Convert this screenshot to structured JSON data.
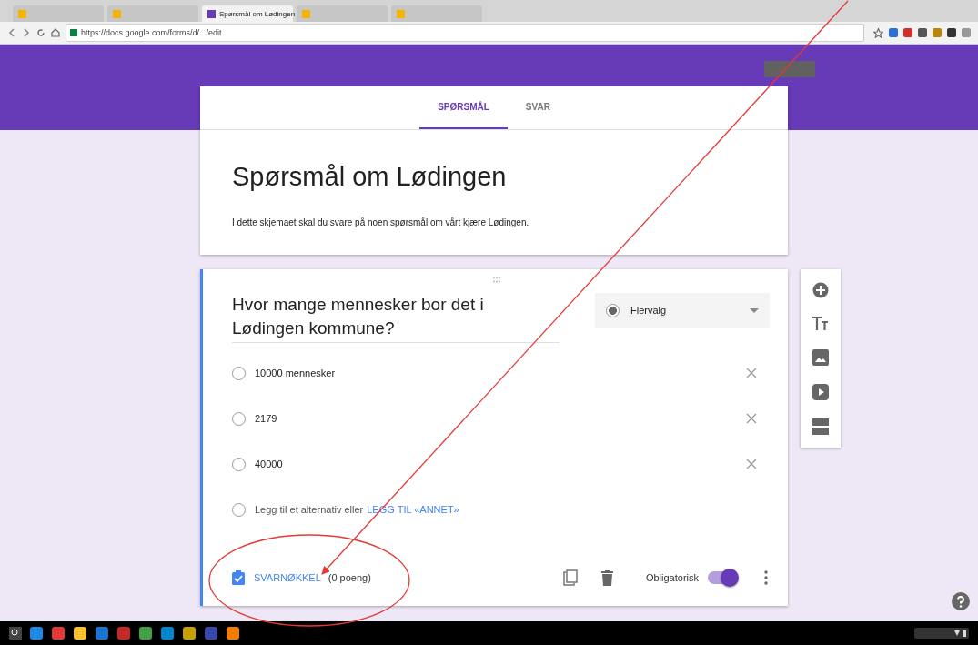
{
  "browser": {
    "tabs": [
      {
        "selected": false
      },
      {
        "selected": false
      },
      {
        "title": "Spørsmål om Lødingen",
        "selected": true
      },
      {
        "selected": false
      },
      {
        "selected": false
      }
    ],
    "address": "https://docs.google.com/forms/d/.../edit"
  },
  "form_tabs": [
    {
      "label": "SPØRSMÅL",
      "selected": true
    },
    {
      "label": "SVAR",
      "selected": false
    }
  ],
  "form": {
    "title": "Spørsmål om Lødingen",
    "description": "I dette skjemaet skal du svare på noen spørsmål om vårt kjære Lødingen."
  },
  "question": {
    "text": "Hvor mange mennesker bor det i Lødingen kommune?",
    "type": "Flervalg",
    "options": [
      {
        "kind": "option",
        "label": "10000 mennesker",
        "selected": false
      },
      {
        "kind": "option",
        "label": "2179",
        "selected": false
      },
      {
        "kind": "option",
        "label": "40000",
        "selected": false
      },
      {
        "kind": "add",
        "label": "Legg til et alternativ eller",
        "link": "LEGG TIL «ANNET»",
        "selected": false
      }
    ],
    "answer_key": "SVARNØKKEL",
    "points": "(0 poeng)",
    "required_label": "Obligatorisk",
    "required": true
  }
}
